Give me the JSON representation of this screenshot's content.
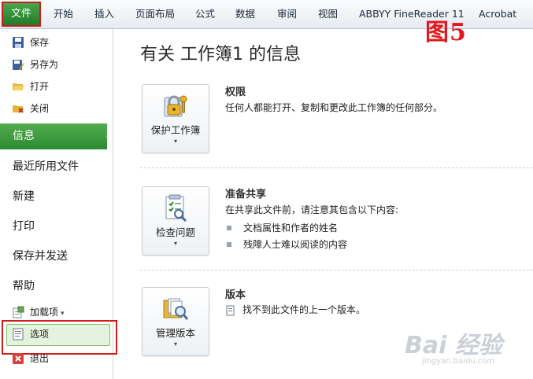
{
  "ribbon": {
    "file_tab": "文件",
    "tabs": [
      "开始",
      "插入",
      "页面布局",
      "公式",
      "数据",
      "审阅",
      "视图",
      "ABBYY FineReader 11",
      "Acrobat"
    ]
  },
  "annotation": {
    "figure_label": "图5"
  },
  "nav": {
    "save": "保存",
    "save_as": "另存为",
    "open": "打开",
    "close": "关闭",
    "info": "信息",
    "recent": "最近所用文件",
    "new": "新建",
    "print": "打印",
    "save_send": "保存并发送",
    "help": "帮助",
    "addins": "加载项",
    "options": "选项",
    "exit": "退出"
  },
  "main": {
    "title": "有关 工作簿1 的信息",
    "permissions": {
      "button_label": "保护工作簿",
      "title": "权限",
      "description": "任何人都能打开、复制和更改此工作簿的任何部分。"
    },
    "prepare": {
      "button_label": "检查问题",
      "title": "准备共享",
      "description": "在共享此文件前，请注意其包含以下内容:",
      "bullets": [
        "文档属性和作者的姓名",
        "残障人士难以阅读的内容"
      ]
    },
    "versions": {
      "button_label": "管理版本",
      "title": "版本",
      "description": "找不到此文件的上一个版本。"
    }
  },
  "watermark": {
    "main": "Bai 经验",
    "sub": "jingyan.baidu.com"
  },
  "colors": {
    "accent_green": "#2b8a30",
    "highlight_red": "#d11a1a"
  }
}
